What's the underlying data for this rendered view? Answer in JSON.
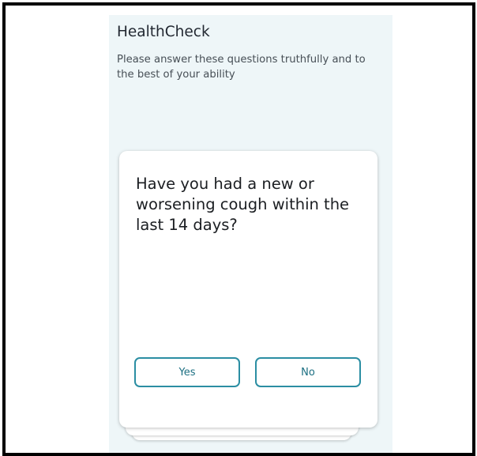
{
  "app": {
    "title": "HealthCheck",
    "subtitle": "Please answer these questions truthfully and to the best of your ability"
  },
  "question_card": {
    "question": "Have you had a new or worsening cough within the last 14 days?",
    "yes_label": "Yes",
    "no_label": "No"
  },
  "colors": {
    "screen_background": "#eef6f8",
    "card_background": "#ffffff",
    "accent": "#2b8ea3",
    "text_primary": "#1b1e22"
  }
}
